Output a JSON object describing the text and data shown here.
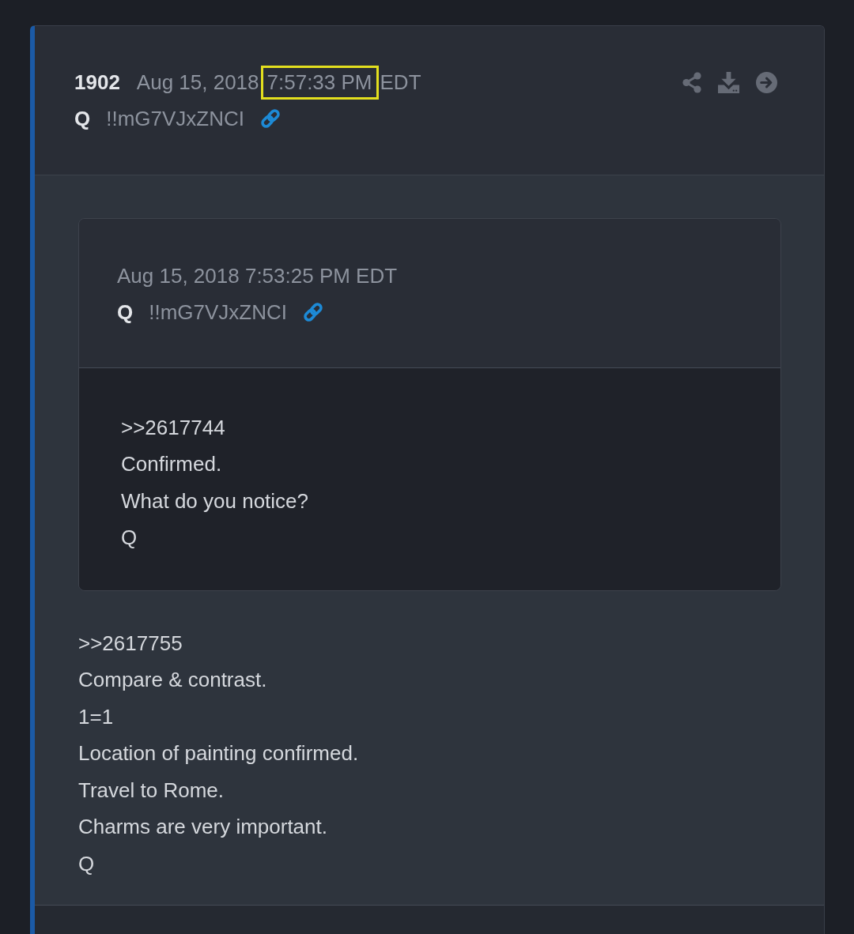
{
  "post": {
    "number": "1902",
    "timestamp": [
      {
        "text": "Aug 15, 2018",
        "highlighted": false
      },
      {
        "text": "7:57:33 PM",
        "highlighted": true
      },
      {
        "text": "EDT",
        "highlighted": false
      }
    ],
    "author": "Q",
    "tripcode": "!!mG7VJxZNCI",
    "quote": {
      "timestamp": "Aug 15, 2018 7:53:25 PM EDT",
      "author": "Q",
      "tripcode": "!!mG7VJxZNCI",
      "lines": [
        ">>2617744",
        "Confirmed.",
        "What do you notice?",
        "Q"
      ]
    },
    "lines": [
      ">>2617755",
      "Compare & contrast.",
      "1=1",
      "Location of painting confirmed.",
      "Travel to Rome.",
      "Charms are very important.",
      "Q"
    ]
  }
}
